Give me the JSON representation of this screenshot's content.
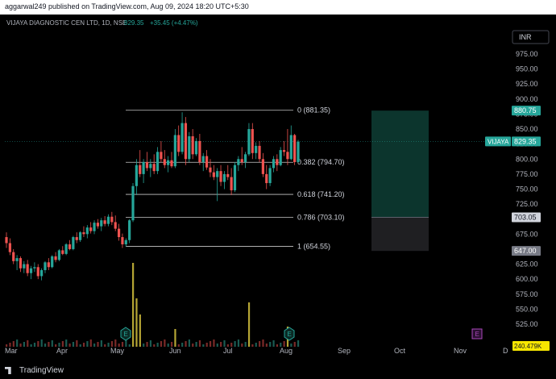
{
  "header": {
    "published": "aggarwal249 published on TradingView.com, Aug 09, 2024 18:20 UTC+5:30"
  },
  "symbol": {
    "title": "VIJAYA DIAGNOSTIC CEN LTD, 1D, NSE",
    "last": "829.35",
    "change": "+35.45 (+4.47%)",
    "tag": "VIJAYA",
    "currency": "INR"
  },
  "footer": {
    "brand": "TradingView"
  },
  "colors": {
    "up": "#26a69a",
    "down": "#ef5350",
    "volume": "#b5a534",
    "grid_text": "#b2b5be",
    "earnings": "#26a69a",
    "dividend": "#ab47bc",
    "target_zone": "#0d3b32",
    "stop_zone": "#1f1f22"
  },
  "icons": {
    "earnings": "E",
    "dividend": "E"
  },
  "chart_data": {
    "type": "candlestick",
    "title": "VIJAYA DIAGNOSTIC CEN LTD, 1D, NSE",
    "y_axis": {
      "range": [
        501,
        995
      ],
      "ticks": [
        "975.00",
        "950.00",
        "925.00",
        "900.00",
        "875.00",
        "850.00",
        "825.00",
        "800.00",
        "775.00",
        "750.00",
        "725.00",
        "700.00",
        "675.00",
        "650.00",
        "625.00",
        "600.00",
        "575.00",
        "550.00",
        "525.00"
      ]
    },
    "x_axis": {
      "labels": [
        "Mar",
        "Apr",
        "May",
        "Jun",
        "Jul",
        "Aug",
        "Sep",
        "Oct",
        "Nov",
        "D"
      ]
    },
    "price_labels": [
      {
        "value": 880.75,
        "text": "880.75",
        "style": "target"
      },
      {
        "value": 829.35,
        "text": "829.35",
        "style": "last"
      },
      {
        "value": 703.05,
        "text": "703.05",
        "style": "entry"
      },
      {
        "value": 647.0,
        "text": "647.00",
        "style": "stop"
      }
    ],
    "fibonacci": [
      {
        "level": "0",
        "price": 881.35,
        "label": "0 (881.35)"
      },
      {
        "level": "0.382",
        "price": 794.7,
        "label": "0.382 (794.70)"
      },
      {
        "level": "0.618",
        "price": 741.2,
        "label": "0.618 (741.20)"
      },
      {
        "level": "0.786",
        "price": 703.1,
        "label": "0.786 (703.10)"
      },
      {
        "level": "1",
        "price": 654.55,
        "label": "1 (654.55)"
      }
    ],
    "position": {
      "target": 880.75,
      "entry": 703.05,
      "stop": 647.0
    },
    "volume_label": "240.479K",
    "events": [
      {
        "type": "earnings",
        "x_index": 58
      },
      {
        "type": "earnings",
        "x_index": 131
      },
      {
        "type": "dividend",
        "x_index": 214
      }
    ],
    "candles_approx": [
      [
        670,
        678,
        652,
        660
      ],
      [
        660,
        668,
        640,
        645
      ],
      [
        645,
        650,
        625,
        630
      ],
      [
        630,
        640,
        615,
        635
      ],
      [
        635,
        638,
        612,
        618
      ],
      [
        618,
        630,
        610,
        625
      ],
      [
        625,
        632,
        605,
        610
      ],
      [
        610,
        622,
        600,
        618
      ],
      [
        618,
        628,
        612,
        620
      ],
      [
        620,
        625,
        600,
        605
      ],
      [
        605,
        618,
        598,
        615
      ],
      [
        615,
        630,
        610,
        628
      ],
      [
        628,
        635,
        615,
        620
      ],
      [
        620,
        640,
        618,
        638
      ],
      [
        638,
        645,
        628,
        632
      ],
      [
        632,
        650,
        630,
        648
      ],
      [
        648,
        655,
        640,
        642
      ],
      [
        642,
        660,
        640,
        658
      ],
      [
        658,
        665,
        648,
        650
      ],
      [
        650,
        672,
        648,
        670
      ],
      [
        670,
        678,
        660,
        665
      ],
      [
        665,
        680,
        662,
        678
      ],
      [
        678,
        688,
        670,
        675
      ],
      [
        675,
        690,
        668,
        686
      ],
      [
        686,
        695,
        676,
        680
      ],
      [
        680,
        698,
        675,
        694
      ],
      [
        694,
        700,
        684,
        688
      ],
      [
        688,
        702,
        680,
        698
      ],
      [
        698,
        705,
        688,
        692
      ],
      [
        692,
        708,
        688,
        704
      ],
      [
        704,
        712,
        690,
        695
      ],
      [
        695,
        706,
        680,
        684
      ],
      [
        684,
        692,
        664,
        670
      ],
      [
        670,
        676,
        652,
        658
      ],
      [
        658,
        668,
        654,
        665
      ],
      [
        665,
        700,
        660,
        698
      ],
      [
        698,
        760,
        695,
        755
      ],
      [
        755,
        800,
        740,
        790
      ],
      [
        790,
        815,
        770,
        775
      ],
      [
        775,
        800,
        760,
        795
      ],
      [
        795,
        812,
        780,
        785
      ],
      [
        785,
        800,
        770,
        792
      ],
      [
        792,
        808,
        775,
        780
      ],
      [
        780,
        820,
        775,
        812
      ],
      [
        812,
        830,
        795,
        800
      ],
      [
        800,
        815,
        785,
        790
      ],
      [
        790,
        805,
        778,
        798
      ],
      [
        798,
        812,
        785,
        788
      ],
      [
        788,
        850,
        785,
        840
      ],
      [
        840,
        856,
        805,
        812
      ],
      [
        812,
        878,
        808,
        860
      ],
      [
        860,
        870,
        790,
        800
      ],
      [
        800,
        845,
        795,
        838
      ],
      [
        838,
        850,
        800,
        808
      ],
      [
        808,
        835,
        805,
        830
      ],
      [
        830,
        842,
        790,
        795
      ],
      [
        795,
        810,
        780,
        805
      ],
      [
        805,
        815,
        782,
        786
      ],
      [
        786,
        800,
        770,
        778
      ],
      [
        778,
        790,
        765,
        770
      ],
      [
        770,
        785,
        730,
        780
      ],
      [
        780,
        790,
        755,
        762
      ],
      [
        762,
        780,
        750,
        775
      ],
      [
        775,
        790,
        765,
        770
      ],
      [
        770,
        785,
        740,
        748
      ],
      [
        748,
        795,
        745,
        790
      ],
      [
        790,
        805,
        780,
        800
      ],
      [
        800,
        820,
        790,
        795
      ],
      [
        795,
        812,
        785,
        808
      ],
      [
        808,
        860,
        805,
        850
      ],
      [
        850,
        860,
        800,
        810
      ],
      [
        810,
        828,
        800,
        822
      ],
      [
        822,
        830,
        795,
        800
      ],
      [
        800,
        810,
        770,
        775
      ],
      [
        775,
        790,
        750,
        760
      ],
      [
        760,
        790,
        755,
        785
      ],
      [
        785,
        805,
        778,
        800
      ],
      [
        800,
        808,
        780,
        790
      ],
      [
        790,
        820,
        788,
        815
      ],
      [
        815,
        830,
        805,
        812
      ],
      [
        812,
        850,
        790,
        800
      ],
      [
        800,
        856,
        798,
        840
      ],
      [
        840,
        842,
        790,
        795
      ],
      [
        795,
        832,
        794,
        829
      ]
    ]
  }
}
